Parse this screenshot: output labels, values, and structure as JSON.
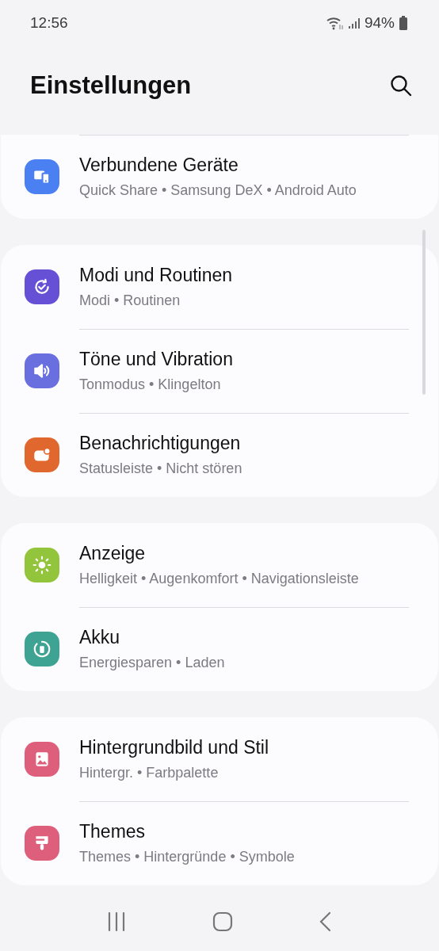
{
  "status_bar": {
    "time": "12:56",
    "battery": "94%"
  },
  "header": {
    "title": "Einstellungen"
  },
  "groups": [
    {
      "items": [
        {
          "title": "Verbundene Geräte",
          "subtitle": "Quick Share • Samsung DeX • Android Auto",
          "color": "#4b80f2"
        }
      ]
    },
    {
      "items": [
        {
          "title": "Modi und Routinen",
          "subtitle": "Modi • Routinen",
          "color": "#6650d6"
        },
        {
          "title": "Töne und Vibration",
          "subtitle": "Tonmodus • Klingelton",
          "color": "#6a6fdf"
        },
        {
          "title": "Benachrichtigungen",
          "subtitle": "Statusleiste • Nicht stören",
          "color": "#e0672e"
        }
      ]
    },
    {
      "items": [
        {
          "title": "Anzeige",
          "subtitle": "Helligkeit • Augenkomfort • Navigationsleiste",
          "color": "#92c43c"
        },
        {
          "title": "Akku",
          "subtitle": "Energiesparen • Laden",
          "color": "#3fa393"
        }
      ]
    },
    {
      "items": [
        {
          "title": "Hintergrundbild und Stil",
          "subtitle": "Hintergr. • Farbpalette",
          "color": "#de5f7c"
        },
        {
          "title": "Themes",
          "subtitle": "Themes • Hintergründe • Symbole",
          "color": "#de5f7c"
        }
      ]
    }
  ]
}
